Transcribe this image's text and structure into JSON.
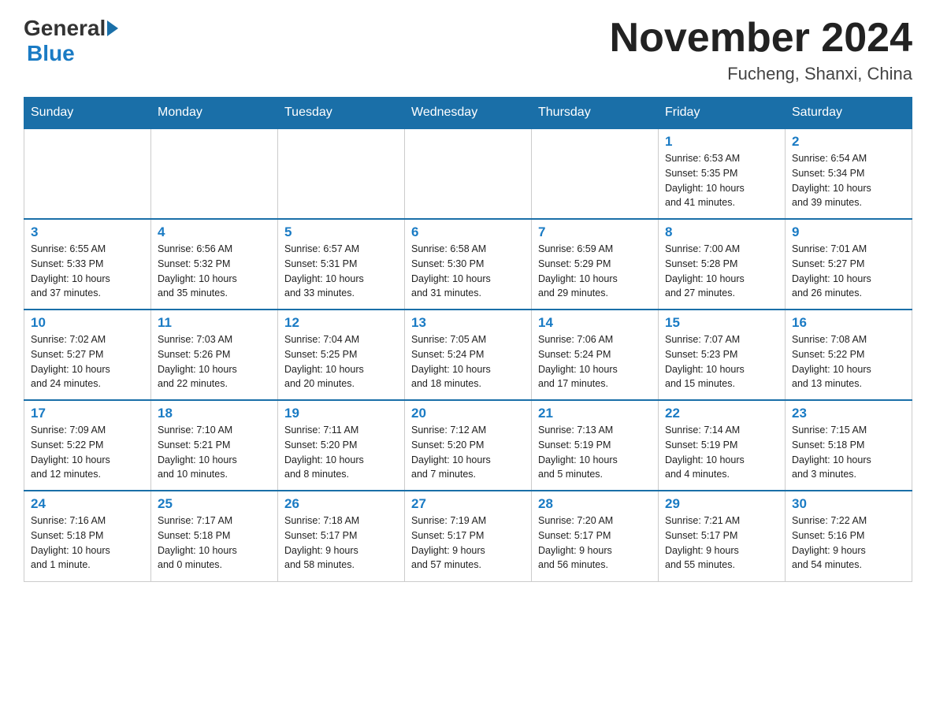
{
  "logo": {
    "general": "General",
    "blue": "Blue"
  },
  "title": {
    "month": "November 2024",
    "location": "Fucheng, Shanxi, China"
  },
  "weekdays": [
    "Sunday",
    "Monday",
    "Tuesday",
    "Wednesday",
    "Thursday",
    "Friday",
    "Saturday"
  ],
  "weeks": [
    [
      {
        "day": "",
        "info": ""
      },
      {
        "day": "",
        "info": ""
      },
      {
        "day": "",
        "info": ""
      },
      {
        "day": "",
        "info": ""
      },
      {
        "day": "",
        "info": ""
      },
      {
        "day": "1",
        "info": "Sunrise: 6:53 AM\nSunset: 5:35 PM\nDaylight: 10 hours\nand 41 minutes."
      },
      {
        "day": "2",
        "info": "Sunrise: 6:54 AM\nSunset: 5:34 PM\nDaylight: 10 hours\nand 39 minutes."
      }
    ],
    [
      {
        "day": "3",
        "info": "Sunrise: 6:55 AM\nSunset: 5:33 PM\nDaylight: 10 hours\nand 37 minutes."
      },
      {
        "day": "4",
        "info": "Sunrise: 6:56 AM\nSunset: 5:32 PM\nDaylight: 10 hours\nand 35 minutes."
      },
      {
        "day": "5",
        "info": "Sunrise: 6:57 AM\nSunset: 5:31 PM\nDaylight: 10 hours\nand 33 minutes."
      },
      {
        "day": "6",
        "info": "Sunrise: 6:58 AM\nSunset: 5:30 PM\nDaylight: 10 hours\nand 31 minutes."
      },
      {
        "day": "7",
        "info": "Sunrise: 6:59 AM\nSunset: 5:29 PM\nDaylight: 10 hours\nand 29 minutes."
      },
      {
        "day": "8",
        "info": "Sunrise: 7:00 AM\nSunset: 5:28 PM\nDaylight: 10 hours\nand 27 minutes."
      },
      {
        "day": "9",
        "info": "Sunrise: 7:01 AM\nSunset: 5:27 PM\nDaylight: 10 hours\nand 26 minutes."
      }
    ],
    [
      {
        "day": "10",
        "info": "Sunrise: 7:02 AM\nSunset: 5:27 PM\nDaylight: 10 hours\nand 24 minutes."
      },
      {
        "day": "11",
        "info": "Sunrise: 7:03 AM\nSunset: 5:26 PM\nDaylight: 10 hours\nand 22 minutes."
      },
      {
        "day": "12",
        "info": "Sunrise: 7:04 AM\nSunset: 5:25 PM\nDaylight: 10 hours\nand 20 minutes."
      },
      {
        "day": "13",
        "info": "Sunrise: 7:05 AM\nSunset: 5:24 PM\nDaylight: 10 hours\nand 18 minutes."
      },
      {
        "day": "14",
        "info": "Sunrise: 7:06 AM\nSunset: 5:24 PM\nDaylight: 10 hours\nand 17 minutes."
      },
      {
        "day": "15",
        "info": "Sunrise: 7:07 AM\nSunset: 5:23 PM\nDaylight: 10 hours\nand 15 minutes."
      },
      {
        "day": "16",
        "info": "Sunrise: 7:08 AM\nSunset: 5:22 PM\nDaylight: 10 hours\nand 13 minutes."
      }
    ],
    [
      {
        "day": "17",
        "info": "Sunrise: 7:09 AM\nSunset: 5:22 PM\nDaylight: 10 hours\nand 12 minutes."
      },
      {
        "day": "18",
        "info": "Sunrise: 7:10 AM\nSunset: 5:21 PM\nDaylight: 10 hours\nand 10 minutes."
      },
      {
        "day": "19",
        "info": "Sunrise: 7:11 AM\nSunset: 5:20 PM\nDaylight: 10 hours\nand 8 minutes."
      },
      {
        "day": "20",
        "info": "Sunrise: 7:12 AM\nSunset: 5:20 PM\nDaylight: 10 hours\nand 7 minutes."
      },
      {
        "day": "21",
        "info": "Sunrise: 7:13 AM\nSunset: 5:19 PM\nDaylight: 10 hours\nand 5 minutes."
      },
      {
        "day": "22",
        "info": "Sunrise: 7:14 AM\nSunset: 5:19 PM\nDaylight: 10 hours\nand 4 minutes."
      },
      {
        "day": "23",
        "info": "Sunrise: 7:15 AM\nSunset: 5:18 PM\nDaylight: 10 hours\nand 3 minutes."
      }
    ],
    [
      {
        "day": "24",
        "info": "Sunrise: 7:16 AM\nSunset: 5:18 PM\nDaylight: 10 hours\nand 1 minute."
      },
      {
        "day": "25",
        "info": "Sunrise: 7:17 AM\nSunset: 5:18 PM\nDaylight: 10 hours\nand 0 minutes."
      },
      {
        "day": "26",
        "info": "Sunrise: 7:18 AM\nSunset: 5:17 PM\nDaylight: 9 hours\nand 58 minutes."
      },
      {
        "day": "27",
        "info": "Sunrise: 7:19 AM\nSunset: 5:17 PM\nDaylight: 9 hours\nand 57 minutes."
      },
      {
        "day": "28",
        "info": "Sunrise: 7:20 AM\nSunset: 5:17 PM\nDaylight: 9 hours\nand 56 minutes."
      },
      {
        "day": "29",
        "info": "Sunrise: 7:21 AM\nSunset: 5:17 PM\nDaylight: 9 hours\nand 55 minutes."
      },
      {
        "day": "30",
        "info": "Sunrise: 7:22 AM\nSunset: 5:16 PM\nDaylight: 9 hours\nand 54 minutes."
      }
    ]
  ]
}
